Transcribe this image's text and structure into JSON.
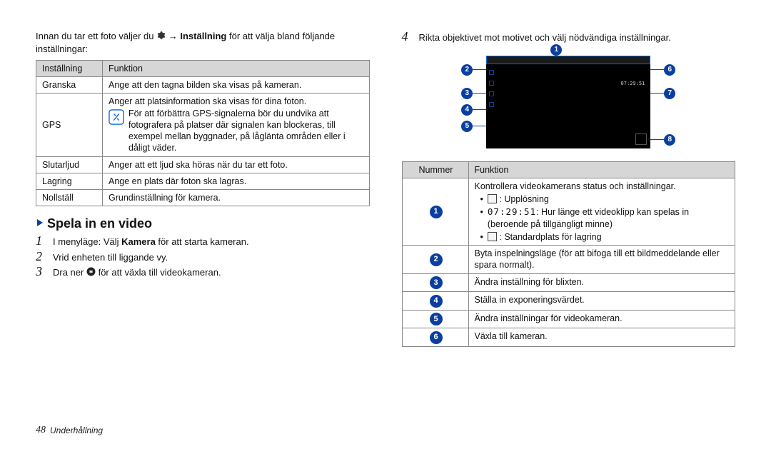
{
  "left": {
    "intro_pre": "Innan du tar ett foto väljer du ",
    "intro_arrow": " → ",
    "intro_bold": "Inställning",
    "intro_post": " för att välja bland följande inställningar:",
    "table_h1": "Inställning",
    "table_h2": "Funktion",
    "rows": [
      {
        "k": "Granska",
        "v": "Ange att den tagna bilden ska visas på kameran."
      },
      {
        "k": "GPS",
        "v_top": "Anger att platsinformation ska visas för dina foton.",
        "v_note": "För att förbättra GPS-signalerna bör du undvika att fotografera på platser där signalen kan blockeras, till exempel mellan byggnader, på låglänta områden eller i dåligt väder."
      },
      {
        "k": "Slutarljud",
        "v": "Anger att ett ljud ska höras när du tar ett foto."
      },
      {
        "k": "Lagring",
        "v": "Ange en plats där foton ska lagras."
      },
      {
        "k": "Nollställ",
        "v": "Grundinställning för kamera."
      }
    ],
    "section_title": "Spela in en video",
    "steps": [
      {
        "n": "1",
        "pre": "I menyläge: Välj ",
        "b": "Kamera",
        "post": " för att starta kameran."
      },
      {
        "n": "2",
        "text": "Vrid enheten till liggande vy."
      },
      {
        "n": "3",
        "pre": "Dra ner ",
        "post": " för att växla till videokameran."
      }
    ]
  },
  "right": {
    "step4": {
      "n": "4",
      "text": "Rikta objektivet mot motivet och välj nödvändiga inställningar."
    },
    "callout_1": "1",
    "callout_2": "2",
    "callout_3": "3",
    "callout_4": "4",
    "callout_5": "5",
    "callout_6": "6",
    "callout_7": "7",
    "callout_8": "8",
    "screen_time": "07:29:51",
    "table_h1": "Nummer",
    "table_h2": "Funktion",
    "row1_top": "Kontrollera videokamerans status och inställningar.",
    "row1_b1_post": ": Upplösning",
    "row1_b2_time": "07:29:51",
    "row1_b2_post": ": Hur länge ett videoklipp kan spelas in (beroende på tillgängligt minne)",
    "row1_b3_post": ": Standardplats för lagring",
    "row2": "Byta inspelningsläge (för att bifoga till ett bildmeddelande eller spara normalt).",
    "row3": "Ändra inställning för blixten.",
    "row4": "Ställa in exponeringsvärdet.",
    "row5": "Ändra inställningar för videokameran.",
    "row6": "Växla till kameran."
  },
  "footer": {
    "page": "48",
    "section": "Underhållning"
  }
}
